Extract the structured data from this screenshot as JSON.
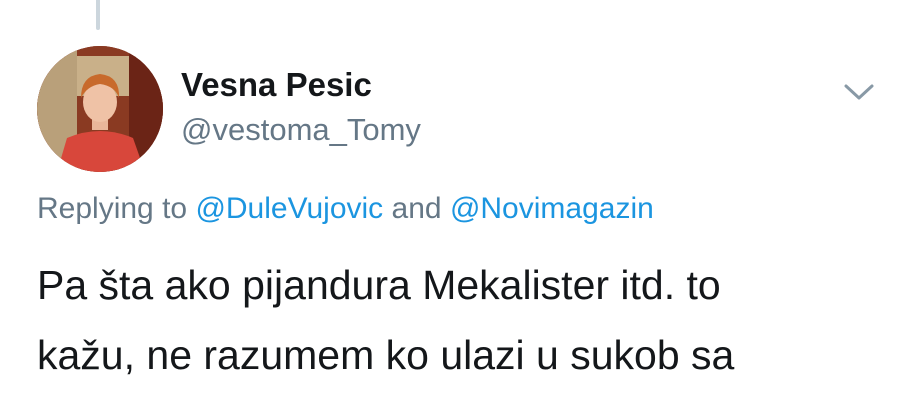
{
  "tweet": {
    "author": {
      "display_name": "Vesna Pesic",
      "handle": "@vestoma_Tomy",
      "avatar": "profile-photo"
    },
    "menu_icon": "chevron-down-icon",
    "reply": {
      "prefix": "Replying to",
      "mention_1": "@DuleVujovic",
      "conjunction": "and",
      "mention_2": "@Novimagazin"
    },
    "text_lines": [
      "Pa šta ako pijandura Mekalister itd. to",
      "kažu, ne razumem ko ulazi u sukob sa"
    ]
  },
  "colors": {
    "link": "#1b95e0",
    "secondary": "#657786",
    "primary_text": "#14171a",
    "thread_line": "#ccd6dd"
  }
}
